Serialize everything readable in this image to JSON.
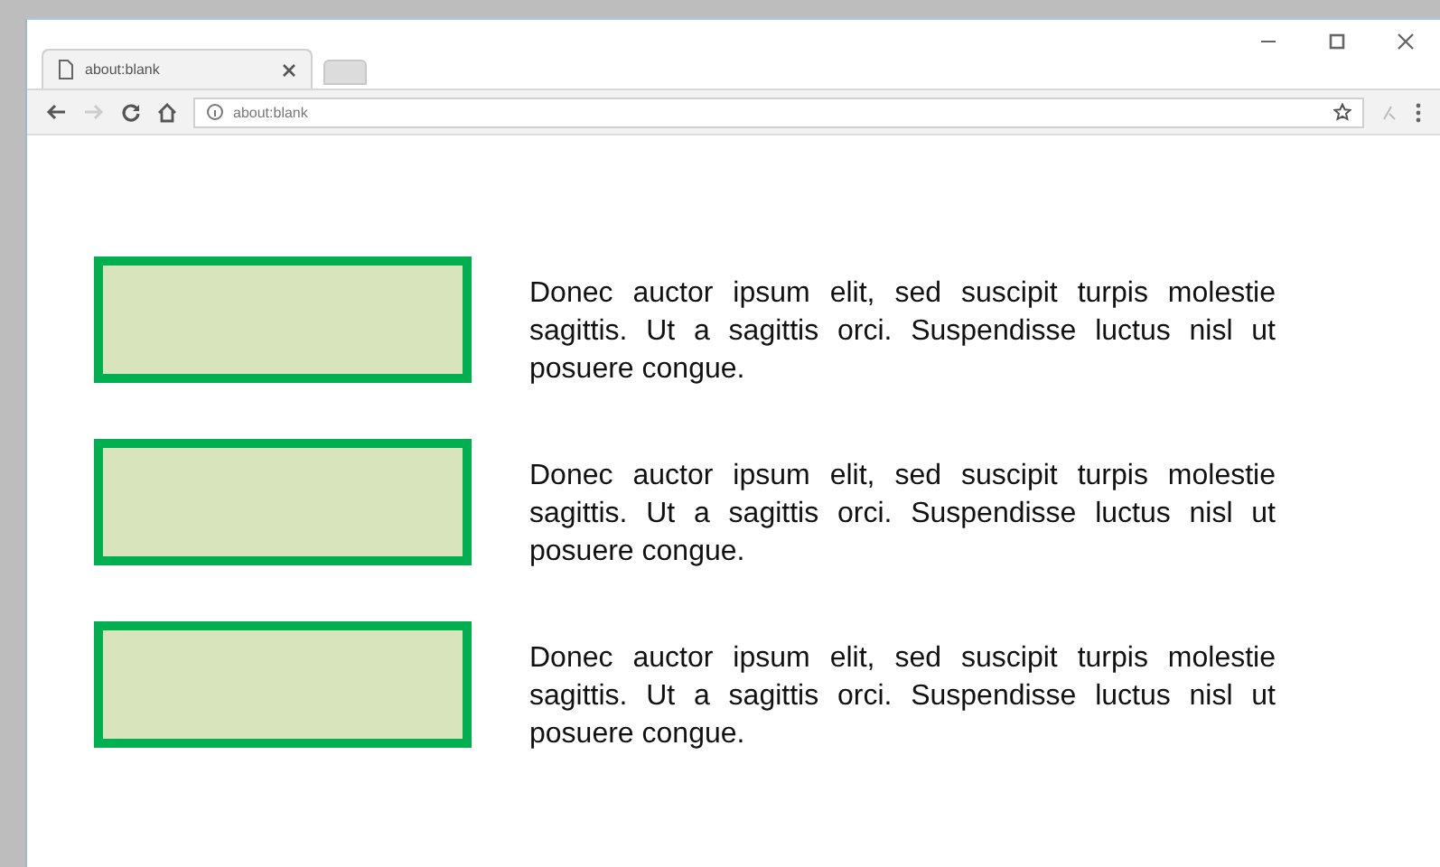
{
  "tab": {
    "title": "about:blank"
  },
  "address_bar": {
    "value": "about:blank"
  },
  "rows": [
    {
      "text": "Donec auctor ipsum elit, sed suscipit turpis molestie sagittis. Ut a sagittis orci. Suspendisse luctus nisl ut posuere congue."
    },
    {
      "text": "Donec auctor ipsum elit, sed suscipit turpis molestie sagittis. Ut a sagittis orci. Suspendisse luctus nisl ut posuere congue."
    },
    {
      "text": "Donec auctor ipsum elit, sed suscipit turpis molestie sagittis. Ut a sagittis orci. Suspendisse luctus nisl ut posuere congue."
    }
  ]
}
